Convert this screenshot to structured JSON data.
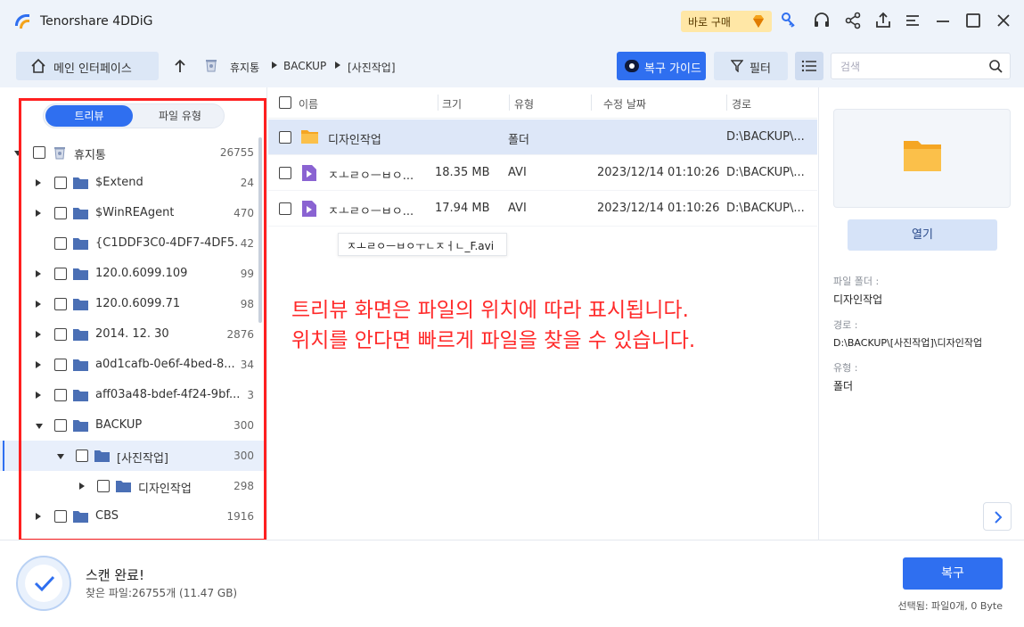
{
  "app": {
    "title": "Tenorshare 4DDiG",
    "buy_label": "바로 구매"
  },
  "toolbar": {
    "home_label": "메인 인터페이스",
    "breadcrumb": [
      "휴지통",
      "BACKUP",
      "[사진작업]"
    ],
    "guide_label": "복구 가이드",
    "filter_label": "필터",
    "search_placeholder": "검색"
  },
  "view_toggle": {
    "tree": "트리뷰",
    "type": "파일 유형"
  },
  "tree": [
    {
      "name": "휴지통",
      "count": "26755"
    },
    {
      "name": "$Extend",
      "count": "24"
    },
    {
      "name": "$WinREAgent",
      "count": "470"
    },
    {
      "name": "{C1DDF3C0-4DF7-4DF5...",
      "count": "42"
    },
    {
      "name": "120.0.6099.109",
      "count": "99"
    },
    {
      "name": "120.0.6099.71",
      "count": "98"
    },
    {
      "name": "2014. 12. 30",
      "count": "2876"
    },
    {
      "name": "a0d1cafb-0e6f-4bed-8...",
      "count": "34"
    },
    {
      "name": "aff03a48-bdef-4f24-9bf...",
      "count": "3"
    },
    {
      "name": "BACKUP",
      "count": "300"
    },
    {
      "name": "[사진작업]",
      "count": "300"
    },
    {
      "name": "디자인작업",
      "count": "298"
    },
    {
      "name": "CBS",
      "count": "1916"
    }
  ],
  "columns": {
    "name": "이름",
    "size": "크기",
    "type": "유형",
    "modified": "수정 날짜",
    "path": "경로"
  },
  "files": [
    {
      "name": "디자인작업",
      "size": "",
      "type": "폴더",
      "modified": "",
      "path": "D:\\BACKUP\\..."
    },
    {
      "name": "ㅈㅗㄹㅇㅡㅂㅇ...",
      "size": "18.35 MB",
      "type": "AVI",
      "modified": "2023/12/14 01:10:26",
      "path": "D:\\BACKUP\\..."
    },
    {
      "name": "ㅈㅗㄹㅇㅡㅂㅇ...",
      "size": "17.94 MB",
      "type": "AVI",
      "modified": "2023/12/14 01:10:26",
      "path": "D:\\BACKUP\\..."
    }
  ],
  "tooltip": "ㅈㅗㄹㅇㅡㅂㅇㅜㄴㅈㅓㄴ_F.avi",
  "annotation": {
    "line1": "트리뷰 화면은 파일의 위치에 따라 표시됩니다.",
    "line2": "위치를 안다면 빠르게 파일을 찾을 수 있습니다."
  },
  "preview": {
    "open_label": "열기",
    "folder_label": "파일 폴더 :",
    "folder_value": "디자인작업",
    "path_label": "경로 :",
    "path_value": "D:\\BACKUP\\[사진작업]\\디자인작업",
    "type_label": "유형 :",
    "type_value": "폴더"
  },
  "status": {
    "title": "스캔 완료!",
    "found": "찾은 파일:26755개 (11.47 GB)",
    "recover_label": "복구",
    "selected": "선택됨: 파일0개, 0 Byte"
  },
  "colors": {
    "accent": "#2f6ff0",
    "folder": "#4a6fb5",
    "annotation": "#ff2a2a"
  }
}
